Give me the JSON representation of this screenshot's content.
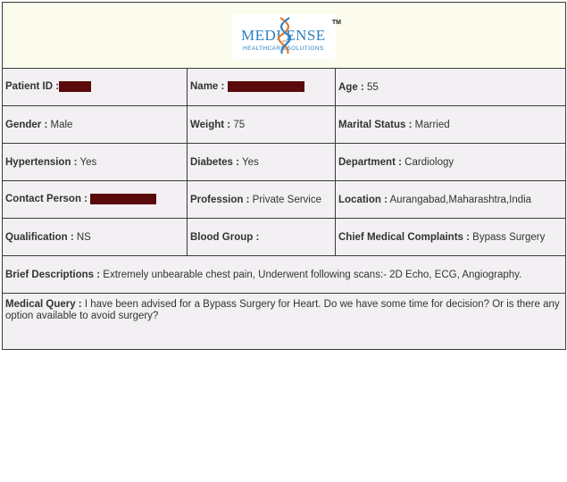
{
  "logo": {
    "brand": "MEDI  ENSE",
    "tagline": "HEALTHCARE SOLUTIONS",
    "trademark": "TM",
    "icon": "dna-helix-icon"
  },
  "rows": [
    [
      {
        "label": "Patient ID :",
        "value": "",
        "redacted": true
      },
      {
        "label": "Name :",
        "value": "",
        "redacted": true
      },
      {
        "label": "Age :",
        "value": " 55"
      }
    ],
    [
      {
        "label": "Gender :",
        "value": " Male"
      },
      {
        "label": "Weight :",
        "value": " 75"
      },
      {
        "label": "Marital Status :",
        "value": " Married"
      }
    ],
    [
      {
        "label": "Hypertension :",
        "value": " Yes"
      },
      {
        "label": "Diabetes :",
        "value": " Yes"
      },
      {
        "label": "Department :",
        "value": " Cardiology"
      }
    ],
    [
      {
        "label": "Contact Person :",
        "value": "",
        "redacted": true
      },
      {
        "label": "Profession :",
        "value": " Private Service"
      },
      {
        "label": "Location :",
        "value": " Aurangabad,Maharashtra,India"
      }
    ],
    [
      {
        "label": "Qualification :",
        "value": " NS"
      },
      {
        "label": "Blood Group :",
        "value": ""
      },
      {
        "label": "Chief Medical Complaints :",
        "value": " Bypass Surgery"
      }
    ]
  ],
  "brief": {
    "label": "Brief Descriptions :",
    "value": " Extremely unbearable chest pain, Underwent following scans:- 2D Echo, ECG, Angiography."
  },
  "query": {
    "label": "Medical Query :",
    "value": " I have been advised for a Bypass Surgery for Heart. Do we have some time for decision? Or is there any option available to avoid surgery?"
  },
  "colors": {
    "header_bg": "#fbfcee",
    "cell_bg": "#f3f0f3",
    "redaction": "#5a0a0a",
    "brand_blue": "#2c80c0",
    "helix_orange": "#e8782a"
  }
}
